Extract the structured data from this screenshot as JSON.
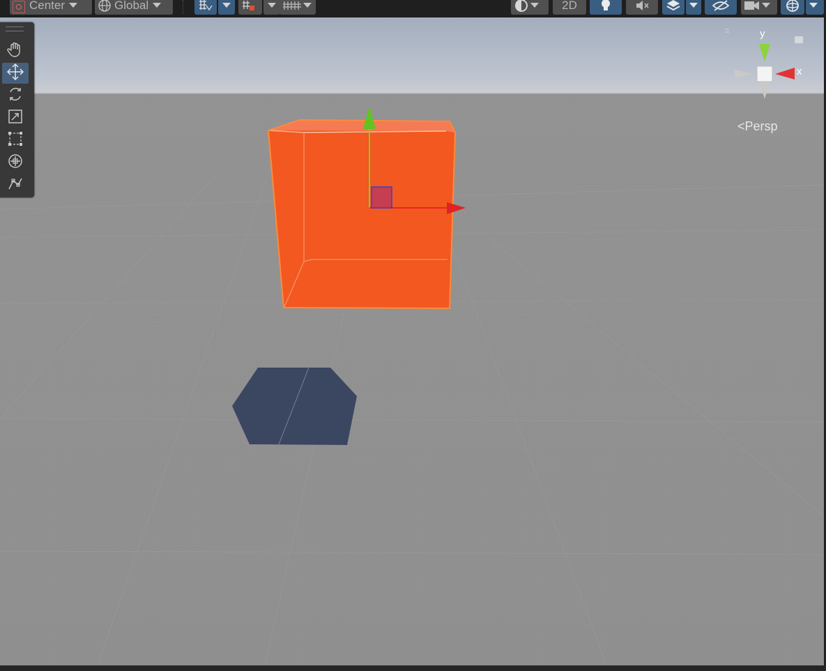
{
  "toolbar": {
    "pivot": {
      "label": "Center",
      "icon": "pivot-center-icon"
    },
    "space": {
      "label": "Global",
      "icon": "globe-icon"
    },
    "mode_2d": "2D",
    "icons": [
      "grid-snap-icon",
      "snap-increment-icon",
      "vertex-snap-icon",
      "shading-mode-icon",
      "lighting-icon",
      "audio-mute-icon",
      "effects-icon",
      "scene-visibility-icon",
      "camera-icon",
      "gizmos-icon"
    ]
  },
  "tools": [
    {
      "name": "hand-tool",
      "icon": "hand-icon",
      "active": false
    },
    {
      "name": "move-tool",
      "icon": "move-arrows-icon",
      "active": true
    },
    {
      "name": "rotate-tool",
      "icon": "rotate-icon",
      "active": false
    },
    {
      "name": "scale-tool",
      "icon": "scale-icon",
      "active": false
    },
    {
      "name": "rect-tool",
      "icon": "rect-transform-icon",
      "active": false
    },
    {
      "name": "transform-tool",
      "icon": "transform-icon",
      "active": false
    },
    {
      "name": "custom-tool",
      "icon": "custom-editor-tool-icon",
      "active": false
    }
  ],
  "gizmo": {
    "y_label": "y",
    "x_label": "x",
    "projection": "Persp"
  },
  "scene": {
    "selected_object_color": "#f2581f",
    "shadow_color": "#3b4661",
    "handle_colors": {
      "x": "#ee2222",
      "y": "#7cd22a",
      "z": "#2f3fc8"
    }
  }
}
